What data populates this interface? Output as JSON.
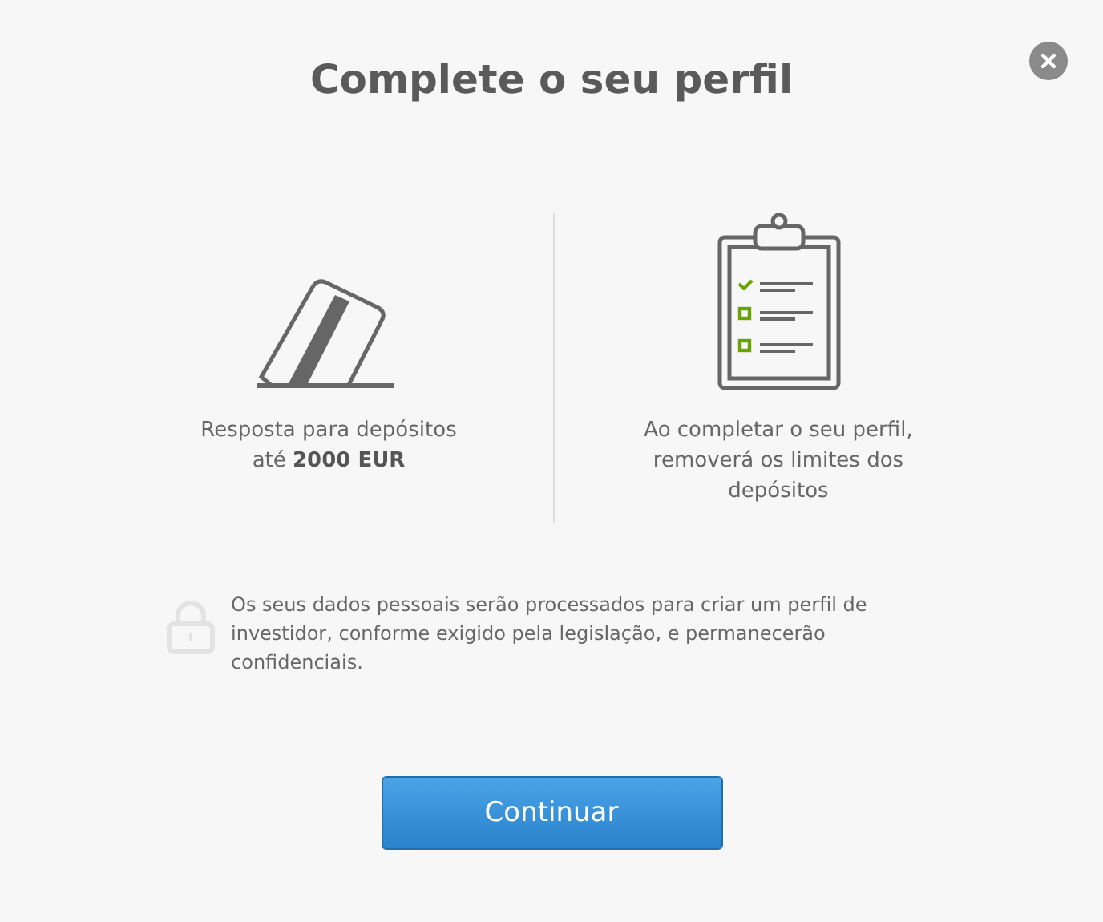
{
  "title": "Complete o seu perfil",
  "features": [
    {
      "kind": "card",
      "text": "Resposta para depósitos\naté **2000 EUR**"
    },
    {
      "kind": "checklist",
      "text": "Ao completar o seu perfil,\nremoverá os limites dos\ndepósitos"
    }
  ],
  "privacy_note": "Os seus dados pessoais serão processados para criar um perfil de investidor, conforme exigido pela legislação, e permanecerão confidenciais.",
  "button": "Continuar"
}
